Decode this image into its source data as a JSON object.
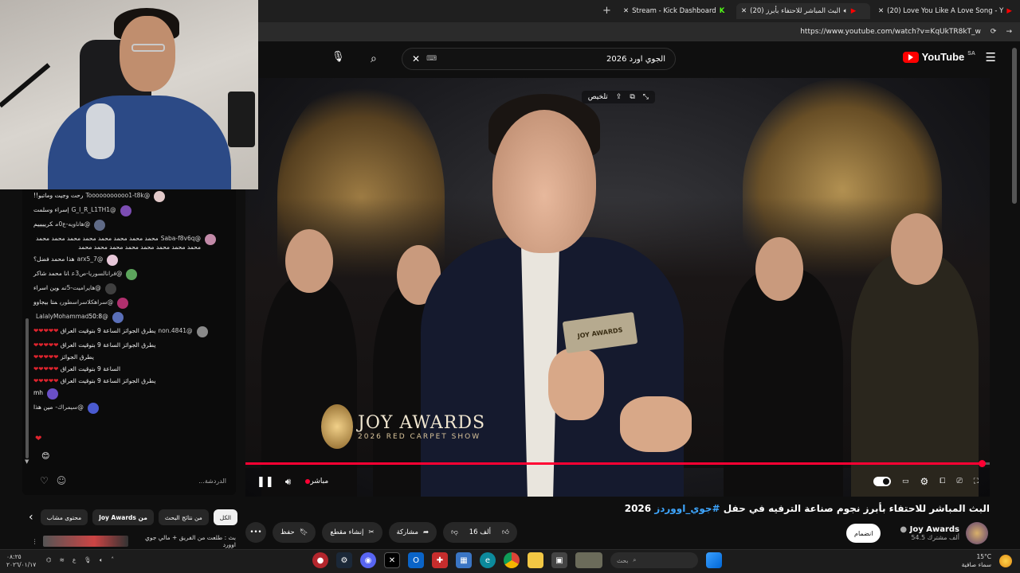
{
  "browser": {
    "tabs": [
      {
        "label": "Stream - Kick Dashboard"
      },
      {
        "label": "(20) البث المباشر للاحتفاء بأبرز"
      },
      {
        "label": "(20) Love You Like A Love Song - Y"
      }
    ],
    "url": "https://www.youtube.com/watch?v=KqUkTR8kT_w"
  },
  "youtube": {
    "brand": "YouTube",
    "country_code": "SA",
    "search_query": "الجوي اورد 2026",
    "video": {
      "overlay_label": "تلخيص",
      "mic_flag": "JOY AWARDS",
      "logo_title": "JOY AWARDS",
      "logo_sub": "2026 RED CARPET SHOW",
      "live_label": "مباشر",
      "progress": 0.99
    },
    "title_main": "البث المباشر للاحتفاء بأبرز نجوم صناعة الترفيه في حفل",
    "title_hashtag": "#جوي_اووردز",
    "title_year": "2026",
    "actions": {
      "likes": "16 ألف",
      "share": "مشاركة",
      "clip": "إنشاء مقطع",
      "save": "حفظ"
    },
    "channel": {
      "name": "Joy Awards",
      "subs": "54.5 ألف مشترك",
      "join_button": "انضمام"
    }
  },
  "chat": {
    "messages": [
      {
        "user": "@Tooooooooooo1-t8k",
        "text": "رحت وجيت وماتبو!!",
        "avatar_color": "#e2c9c9"
      },
      {
        "user": "@G_I_R_L1TH1",
        "text": "إسراء وسلمت",
        "avatar_color": "#7c4db3"
      },
      {
        "user": "@هاناويه-ع0م",
        "text": "كريييييم",
        "avatar_color": "#5f6a86"
      },
      {
        "user": "@Saba-f8v6q",
        "text": "محمد محمد محمد محمد محمد محمد محمد محمد محمد محمد محمد محمد محمد محمد محمد محمد",
        "avatar_color": "#c28aa8"
      },
      {
        "user": "@7_arx5",
        "text": "هذا محمد فضل؟",
        "avatar_color": "#e6c7d8"
      },
      {
        "user": "@فرانالسوريا-ص3ع",
        "text": "انا محمد شاكر",
        "avatar_color": "#5ca55c"
      },
      {
        "user": "@هايراميت-5تم",
        "text": "وين اسراء",
        "avatar_color": "#3f3f3f"
      },
      {
        "user": "@سراهكلاسراسطوري",
        "text": "متا بيجاوو",
        "avatar_color": "#b0306e"
      },
      {
        "user": "@LalalyMohammad",
        "text": "50:8",
        "avatar_color": "#5a6fb8"
      },
      {
        "user": "@non.4841",
        "text": "يطرق الجوائز الساعة 9 بتوقيت العراق",
        "avatar_color": "#8a8a8a"
      },
      {
        "user": "",
        "text": "يطرق الجوائز الساعة 9 بتوقيت العراق",
        "avatar_color": ""
      },
      {
        "user": "",
        "text": "يطرق الجوائز",
        "avatar_color": ""
      },
      {
        "user": "",
        "text": "الساعة 9 بتوقيت العراق",
        "avatar_color": ""
      },
      {
        "user": "",
        "text": "يطرق الجوائز الساعة 9 بتوقيت العراق",
        "avatar_color": ""
      },
      {
        "user": "",
        "text": "mh",
        "avatar_color": "#6a4fc7"
      },
      {
        "user": "@سيمراك-",
        "text": "مين هذا",
        "avatar_color": "#4a5ad0"
      }
    ],
    "input_placeholder": "الدردشة..."
  },
  "chips": [
    {
      "label": "الكل",
      "active": true
    },
    {
      "label": "من نتائج البحث"
    },
    {
      "label": "من Joy Awards"
    },
    {
      "label": "محتوى مشاب"
    }
  ],
  "recommendation": {
    "text": "بث : طلعت من الفريق + مالي جوي اوورد"
  },
  "taskbar": {
    "time": "٠٨:٢٥",
    "date": "٢٠٢٦/٠١/١٧",
    "search_placeholder": "بحث",
    "temperature": "15°C",
    "weather": "سماء صافية"
  },
  "colors": {
    "accent": "#ff0033",
    "hashtag": "#3ea6ff"
  }
}
